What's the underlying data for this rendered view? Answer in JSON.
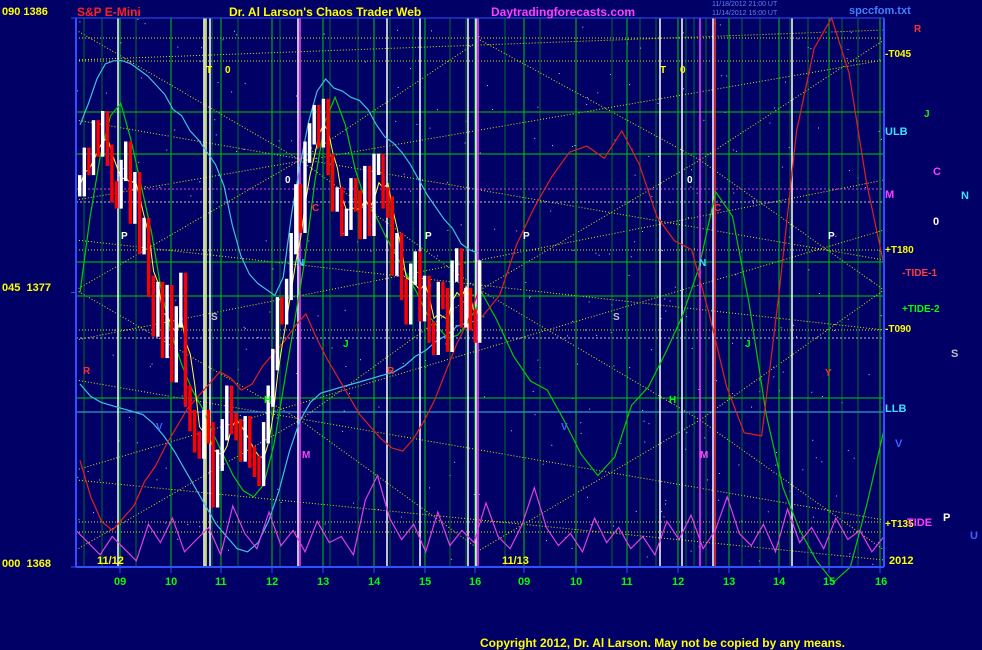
{
  "header": {
    "left_price": "090  1386",
    "symbol": "S&P E-Mini",
    "title": "Dr. Al Larson's Chaos Trader Web",
    "site": "Daytradingforecasts.com",
    "timestamp_1": "11/18/2012 21:00 UT",
    "timestamp_2": "11/14/2012 15:00 UT",
    "file": "spccfom.txt"
  },
  "footer": {
    "copyright": "Copyright 2012, Dr. Al Larson. May not be copied by any means."
  },
  "colors": {
    "background": "#000066",
    "price_up": "#ffffff",
    "price_down": "#ff0000",
    "grid_yellow": "#e6e600",
    "grid_green": "#00cc00",
    "label_yellow": "#ffff00",
    "label_green": "#00ff00",
    "cyan": "#40c0e0",
    "red_line": "#e02020",
    "magenta": "#e040e0",
    "blue_axis": "#3050ff"
  },
  "chart_data": {
    "type": "line",
    "y_axis": {
      "range": [
        1368,
        1386
      ],
      "ticks": [
        {
          "angle": "090",
          "price": "1386",
          "value": 1386
        },
        {
          "angle": "045",
          "price": "1377",
          "value": 1377
        },
        {
          "angle": "000",
          "price": "1368",
          "value": 1368
        }
      ]
    },
    "x_axis": {
      "date_labels": [
        "11/12",
        "11/13",
        "2012"
      ],
      "hour_ticks": [
        "09",
        "10",
        "11",
        "12",
        "13",
        "14",
        "15",
        "16",
        "09",
        "10",
        "11",
        "12",
        "13",
        "14",
        "15",
        "16"
      ]
    },
    "right_labels": [
      {
        "text": "R",
        "color": "#ff3030"
      },
      {
        "text": "-T045",
        "color": "#ffff00"
      },
      {
        "text": "J",
        "color": "#00ff00"
      },
      {
        "text": "ULB",
        "color": "#40e0ff"
      },
      {
        "text": "C",
        "color": "#ff40ff"
      },
      {
        "text": "N",
        "color": "#40e0ff"
      },
      {
        "text": "M",
        "color": "#ff40ff"
      },
      {
        "text": "0",
        "color": "#ffffff"
      },
      {
        "text": "+T180",
        "color": "#ffff00"
      },
      {
        "text": "-TIDE-1",
        "color": "#ff4040"
      },
      {
        "text": "+TIDE-2",
        "color": "#00ff00"
      },
      {
        "text": "-T090",
        "color": "#ffff00"
      },
      {
        "text": "S",
        "color": "#c0c0c0"
      },
      {
        "text": "LLB",
        "color": "#40e0ff"
      },
      {
        "text": "V",
        "color": "#4060ff"
      },
      {
        "text": "+T135",
        "color": "#ffff00"
      },
      {
        "text": "TIDE",
        "color": "#ff40ff"
      },
      {
        "text": "P",
        "color": "#ffffff"
      },
      {
        "text": "U",
        "color": "#4060ff"
      }
    ],
    "in_chart_letters": [
      "T",
      "0",
      "T",
      "0",
      "0",
      "0",
      "P",
      "P",
      "P",
      "P",
      "C",
      "C",
      "N",
      "N",
      "S",
      "S",
      "J",
      "J",
      "H",
      "H",
      "M",
      "M",
      "R",
      "R",
      "V",
      "V",
      "Y"
    ],
    "series": [
      {
        "key": "price",
        "kind": "bars",
        "values": [
          1380.5,
          1381.4,
          1381.2,
          1382.3,
          1381.8,
          1382.6,
          1381.5,
          1380.3,
          1380.1,
          1381.0,
          1381.6,
          1379.6,
          1380.6,
          1378.6,
          1379.1,
          1377.2,
          1375.9,
          1377.0,
          1375.2,
          1376.9,
          1374.4,
          1376.2,
          1377.3,
          1373.6,
          1372.8,
          1372.1,
          1371.9,
          1372.8,
          1372.4,
          1370.3,
          1371.5,
          1372.5,
          1373.6,
          1372.7,
          1372.5,
          1371.8,
          1372.6,
          1371.6,
          1371.3,
          1371.0,
          1372.4,
          1373.6,
          1374.8,
          1376.5,
          1376.3,
          1377.1,
          1378.6,
          1380.2,
          1379.3,
          1381.6,
          1382.2,
          1382.8,
          1382.1,
          1383.0,
          1381.2,
          1380.0,
          1380.1,
          1379.2,
          1379.4,
          1380.4,
          1380.0,
          1379.1,
          1380.8,
          1379.2,
          1381.2,
          1381.2,
          1380.1,
          1379.8,
          1377.9,
          1378.6,
          1377.1,
          1376.3,
          1377.6,
          1378.0,
          1376.4,
          1377.2,
          1375.7,
          1375.3,
          1377.0,
          1376.8,
          1375.4,
          1377.7,
          1378.1,
          1376.2,
          1376.8,
          1376.1,
          1375.7,
          1377.7
        ]
      },
      {
        "key": "ulb",
        "kind": "line",
        "color": "#40c0e0",
        "values": [
          1382.5,
          1383.2,
          1384.0,
          1384.5,
          1384.6,
          1384.6,
          1384.5,
          1384.3,
          1384.1,
          1383.8,
          1383.5,
          1383.0,
          1382.8,
          1382.3,
          1382.0,
          1381.6,
          1381.2,
          1380.5,
          1379.2,
          1378.2,
          1377.6,
          1377.3,
          1377.1,
          1376.9,
          1377.5,
          1379.6,
          1381.2,
          1382.6,
          1383.6,
          1384.0,
          1383.7,
          1383.6,
          1383.4,
          1383.3,
          1383.0,
          1382.5,
          1382.1,
          1381.9,
          1381.6,
          1381.2,
          1380.7,
          1380.2,
          1379.8,
          1379.4,
          1379.1,
          1378.6,
          1378.4,
          1378.3
        ]
      },
      {
        "key": "llb",
        "kind": "line",
        "color": "#40c0e0",
        "values": [
          1374.0,
          1373.6,
          1373.4,
          1373.3,
          1373.2,
          1373.1,
          1373.0,
          1372.7,
          1372.3,
          1371.8,
          1371.2,
          1370.6,
          1370.0,
          1369.4,
          1369.0,
          1368.6,
          1368.5,
          1368.8,
          1369.5,
          1370.5,
          1371.8,
          1372.8,
          1373.4,
          1373.7,
          1373.8,
          1373.9,
          1374.0,
          1374.1,
          1374.2,
          1374.3,
          1374.4,
          1374.6,
          1374.9,
          1375.1,
          1375.4,
          1375.6,
          1375.9,
          1376.0,
          1376.1
        ]
      },
      {
        "key": "green_band",
        "kind": "line",
        "color": "#00cc00",
        "values": [
          1377.0,
          1379.5,
          1381.5,
          1382.8,
          1383.2,
          1382.0,
          1380.5,
          1379.0,
          1377.0,
          1375.6,
          1374.6,
          1373.8,
          1373.2,
          1372.4,
          1371.7,
          1371.0,
          1370.5,
          1370.3,
          1370.7,
          1372.0,
          1374.0,
          1376.0,
          1378.0,
          1380.6,
          1382.6,
          1383.4,
          1382.5,
          1381.0,
          1380.0,
          1379.5,
          1378.8,
          1378.2,
          1377.6,
          1377.0,
          1376.3,
          1375.9,
          1375.5,
          1375.6,
          1376.0,
          1376.6
        ]
      },
      {
        "key": "tide_minus_1",
        "kind": "line",
        "color": "#e02020",
        "values": [
          1371.5,
          1370.3,
          1369.5,
          1369.2,
          1369.6,
          1370.0,
          1370.8,
          1371.3,
          1372.0,
          1372.6,
          1373.2,
          1373.6,
          1374.0,
          1374.4,
          1374.2,
          1373.8,
          1374.0,
          1374.6,
          1375.0,
          1375.4,
          1375.9,
          1376.3,
          1375.5,
          1374.8,
          1374.2,
          1373.6,
          1373.0,
          1372.6,
          1372.2,
          1371.9,
          1371.8,
          1372.2,
          1372.8,
          1373.5,
          1374.4,
          1375.3,
          1376.0,
          1377.0
        ]
      },
      {
        "key": "projection_green",
        "kind": "line",
        "color": "#00cc00",
        "values": [
          1377.1,
          1376.1,
          1374.9,
          1374.1,
          1373.8,
          1372.8,
          1371.7,
          1371.0,
          1371.6,
          1373.3,
          1373.9,
          1375.0,
          1376.2,
          1377.8,
          1380.3,
          1379.5,
          1376.6,
          1373.0,
          1370.6,
          1369.2,
          1368.2,
          1367.5,
          1368.0,
          1370.1,
          1372.5
        ]
      },
      {
        "key": "projection_red",
        "kind": "line",
        "color": "#e02020",
        "values": [
          1376.2,
          1376.9,
          1378.6,
          1379.8,
          1380.8,
          1381.6,
          1381.8,
          1381.4,
          1382.3,
          1381.2,
          1379.5,
          1378.7,
          1378.4,
          1376.3,
          1373.9,
          1372.4,
          1372.3,
          1377.0,
          1382.3,
          1385.0,
          1386.0,
          1384.2,
          1380.6,
          1377.9
        ]
      },
      {
        "key": "tide",
        "kind": "line",
        "color": "#e040e0",
        "values": [
          1369.2,
          1368.8,
          1368.4,
          1369.0,
          1368.6,
          1368.2,
          1369.4,
          1368.8,
          1369.6,
          1368.5,
          1368.9,
          1369.3,
          1368.4,
          1370.0,
          1369.1,
          1368.6,
          1369.8,
          1368.7,
          1369.2,
          1368.5,
          1369.5,
          1368.8,
          1369.0,
          1368.4,
          1370.2,
          1371.0,
          1369.6,
          1368.9,
          1369.4,
          1368.5,
          1369.8,
          1368.7,
          1369.2,
          1368.8,
          1370.1,
          1369.0,
          1368.6,
          1369.4,
          1370.6,
          1369.3,
          1368.7,
          1369.1,
          1368.5,
          1369.6,
          1368.8,
          1369.3,
          1368.6,
          1369.0,
          1368.4,
          1369.5,
          1368.9,
          1369.7,
          1368.6,
          1369.2,
          1370.3,
          1369.1,
          1368.7,
          1369.4,
          1368.5,
          1369.9,
          1368.8,
          1369.3,
          1368.6,
          1369.6,
          1368.9,
          1369.2,
          1368.5,
          1369.0
        ]
      }
    ]
  }
}
